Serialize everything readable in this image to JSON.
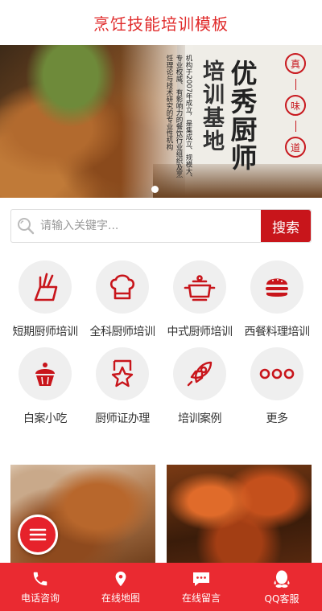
{
  "header": {
    "title": "烹饪技能培训模板"
  },
  "banner": {
    "title_main": "优秀厨师",
    "title_sub": "培训基地",
    "description": "机构于2007年成立，是集成立、规模大、专业权威、有影响力的餐饮行业组织及烹饪理论与技术研究的专业性机构",
    "seals": [
      "真",
      "味",
      "道"
    ]
  },
  "search": {
    "placeholder": "请输入关键字...",
    "button_label": "搜索"
  },
  "categories": [
    {
      "label": "短期厨师培训",
      "icon": "knife-block-icon"
    },
    {
      "label": "全科厨师培训",
      "icon": "chef-hat-icon"
    },
    {
      "label": "中式厨师培训",
      "icon": "cooking-pot-icon"
    },
    {
      "label": "西餐料理培训",
      "icon": "burger-icon"
    },
    {
      "label": "白案小吃",
      "icon": "cupcake-icon"
    },
    {
      "label": "厨师证办理",
      "icon": "certificate-star-icon"
    },
    {
      "label": "培训案例",
      "icon": "rocket-icon"
    },
    {
      "label": "更多",
      "icon": "more-dots-icon"
    }
  ],
  "footer": [
    {
      "label": "电话咨询",
      "icon": "phone-icon"
    },
    {
      "label": "在线地图",
      "icon": "map-pin-icon"
    },
    {
      "label": "在线留言",
      "icon": "chat-bubble-icon"
    },
    {
      "label": "QQ客服",
      "icon": "qq-icon"
    }
  ],
  "colors": {
    "brand_red": "#e02b2b",
    "button_red": "#c8151b",
    "footer_red": "#ea2a31",
    "icon_bg": "#efefef"
  }
}
